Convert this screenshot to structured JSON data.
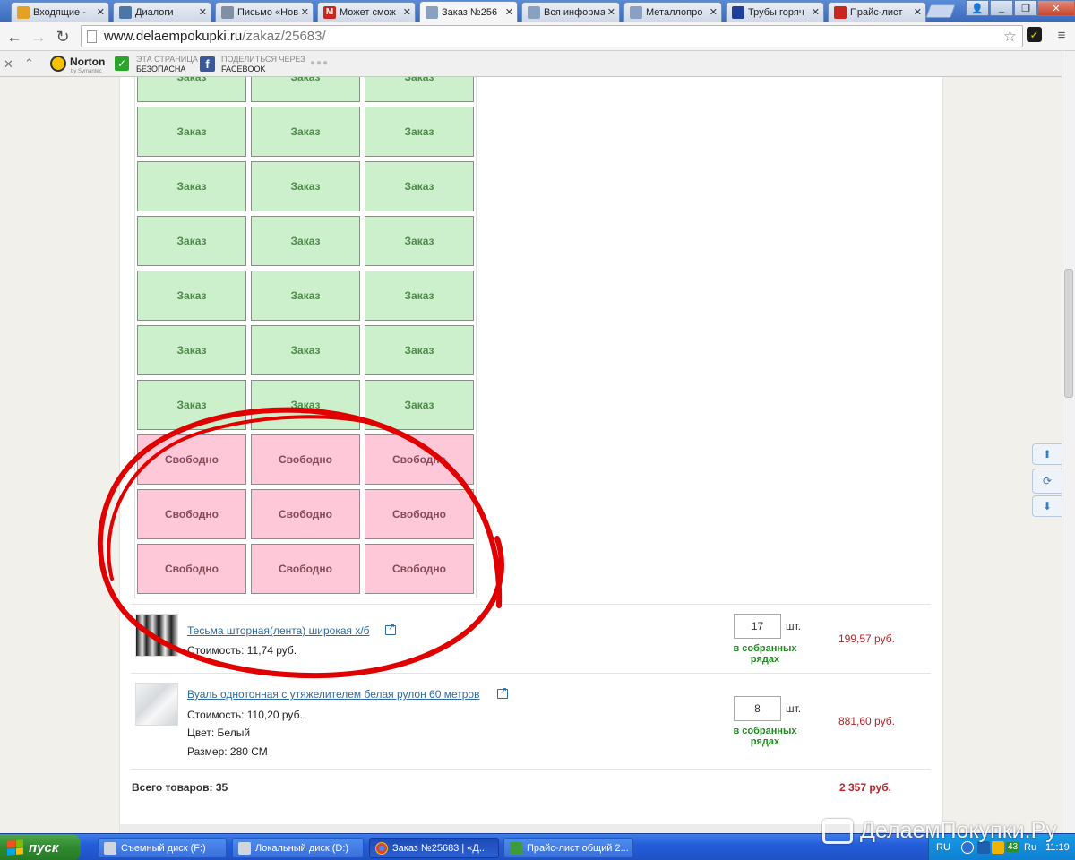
{
  "browser": {
    "tabs": [
      {
        "label": "Входящие - ",
        "favicon": "mail-icon",
        "color": "#e4a224"
      },
      {
        "label": "Диалоги",
        "favicon": "chat-icon",
        "color": "#4a76a8"
      },
      {
        "label": "Письмо «Нов",
        "favicon": "letter-icon",
        "color": "#7f8fa6"
      },
      {
        "label": "Может смож",
        "favicon": "m-icon",
        "color": "#c8261e",
        "glyph": "M"
      },
      {
        "label": "Заказ №256",
        "favicon": "page-icon",
        "color": "#8aa0c0",
        "active": true
      },
      {
        "label": "Вся информа",
        "favicon": "page-icon",
        "color": "#8aa0c0"
      },
      {
        "label": "Металлопро",
        "favicon": "doc-icon",
        "color": "#8aa0c0"
      },
      {
        "label": "Трубы горяч",
        "favicon": "chart-icon",
        "color": "#1f3f9a"
      },
      {
        "label": "Прайс-лист",
        "favicon": "star-icon",
        "color": "#c8261e"
      }
    ],
    "url_host": "www.delaempokupki.ru",
    "url_path": "/zakaz/25683/"
  },
  "norton_bar": {
    "norton_label": "Norton",
    "norton_sub": "by Symantec",
    "safe_line1": "ЭТА СТРАНИЦА",
    "safe_line2": "БЕЗОПАСНА",
    "share_line1": "ПОДЕЛИТЬСЯ ЧЕРЕЗ",
    "share_line2": "FACEBOOK",
    "more": "●●●"
  },
  "grid": {
    "ordered_label": "Заказ",
    "free_label": "Свободно",
    "rows": [
      [
        "ordered",
        "ordered",
        "ordered"
      ],
      [
        "ordered",
        "ordered",
        "ordered"
      ],
      [
        "ordered",
        "ordered",
        "ordered"
      ],
      [
        "ordered",
        "ordered",
        "ordered"
      ],
      [
        "ordered",
        "ordered",
        "ordered"
      ],
      [
        "ordered",
        "ordered",
        "ordered"
      ],
      [
        "ordered",
        "ordered",
        "ordered"
      ],
      [
        "free",
        "free",
        "free"
      ],
      [
        "free",
        "free",
        "free"
      ],
      [
        "free",
        "free",
        "free"
      ]
    ]
  },
  "products": [
    {
      "name": "Тесьма шторная(лента) широкая х/б",
      "cost": "Стоимость: 11,74 руб.",
      "extra": [],
      "qty": "17",
      "unit": "шт.",
      "note_line1": "в собранных",
      "note_line2": "рядах",
      "price": "199,57 руб."
    },
    {
      "name": "Вуаль однотонная с утяжелителем белая рулон 60 метров",
      "cost": "Стоимость: 110,20 руб.",
      "extra": [
        "Цвет: Белый",
        "Размер: 280 СМ"
      ],
      "qty": "8",
      "unit": "шт.",
      "note_line1": "в собранных",
      "note_line2": "рядах",
      "price": "881,60 руб."
    }
  ],
  "total": {
    "label": "Всего товаров: 35",
    "price": "2 357 руб."
  },
  "taskbar": {
    "start": "пуск",
    "tasks": [
      {
        "label": "Съемный диск (F:)"
      },
      {
        "label": "Локальный диск (D:)"
      },
      {
        "label": "Заказ №25683 | «Д..."
      },
      {
        "label": "Прайс-лист общий 2..."
      }
    ],
    "tray_lang": "RU",
    "tray_lang2": "Ru",
    "tray_count": "43",
    "tray_time": "11:19"
  },
  "watermark": "ДелаемПокупки.Ру",
  "colors": {
    "ordered_bg": "#ccf0cc",
    "free_bg": "#ffc8d9",
    "price_red": "#b0242a",
    "note_green": "#1f8a1f",
    "annotation_red": "#e00000"
  }
}
